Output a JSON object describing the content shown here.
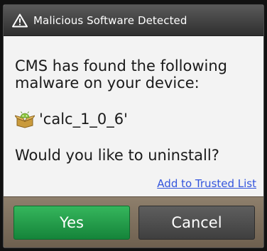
{
  "dialog": {
    "title": "Malicious Software Detected",
    "title_icon": "warning-triangle-icon",
    "message": "CMS has found the following malware on your device:",
    "malware": {
      "icon": "android-package-icon",
      "name": "'calc_1_0_6'"
    },
    "question": "Would you like to uninstall?",
    "trusted_link": "Add to Trusted List",
    "buttons": {
      "yes": "Yes",
      "cancel": "Cancel"
    }
  },
  "colors": {
    "yes_button": "#1e9a45",
    "cancel_button": "#4a4a4a",
    "link": "#3355dd",
    "footer": "#7d6e5c"
  }
}
